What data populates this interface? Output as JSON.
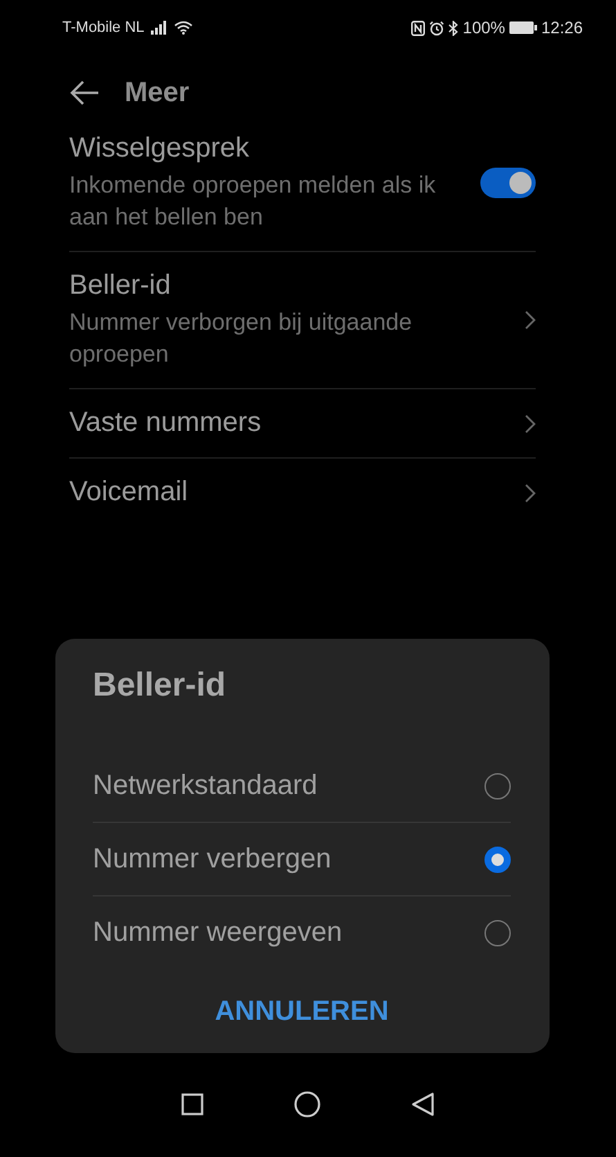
{
  "status_bar": {
    "carrier": "T-Mobile  NL",
    "battery_text": "100%",
    "time": "12:26"
  },
  "header": {
    "title": "Meer"
  },
  "settings": [
    {
      "kind": "toggle",
      "title": "Wisselgesprek",
      "subtitle": "Inkomende oproepen melden als ik aan het bellen ben",
      "on": true
    },
    {
      "kind": "link",
      "title": "Beller-id",
      "subtitle": "Nummer verborgen bij uitgaande oproepen"
    },
    {
      "kind": "link",
      "title": "Vaste nummers"
    },
    {
      "kind": "link",
      "title": "Voicemail"
    }
  ],
  "dialog": {
    "title": "Beller-id",
    "options": [
      {
        "label": "Netwerkstandaard",
        "selected": false
      },
      {
        "label": "Nummer verbergen",
        "selected": true
      },
      {
        "label": "Nummer weergeven",
        "selected": false
      }
    ],
    "cancel": "ANNULEREN"
  }
}
